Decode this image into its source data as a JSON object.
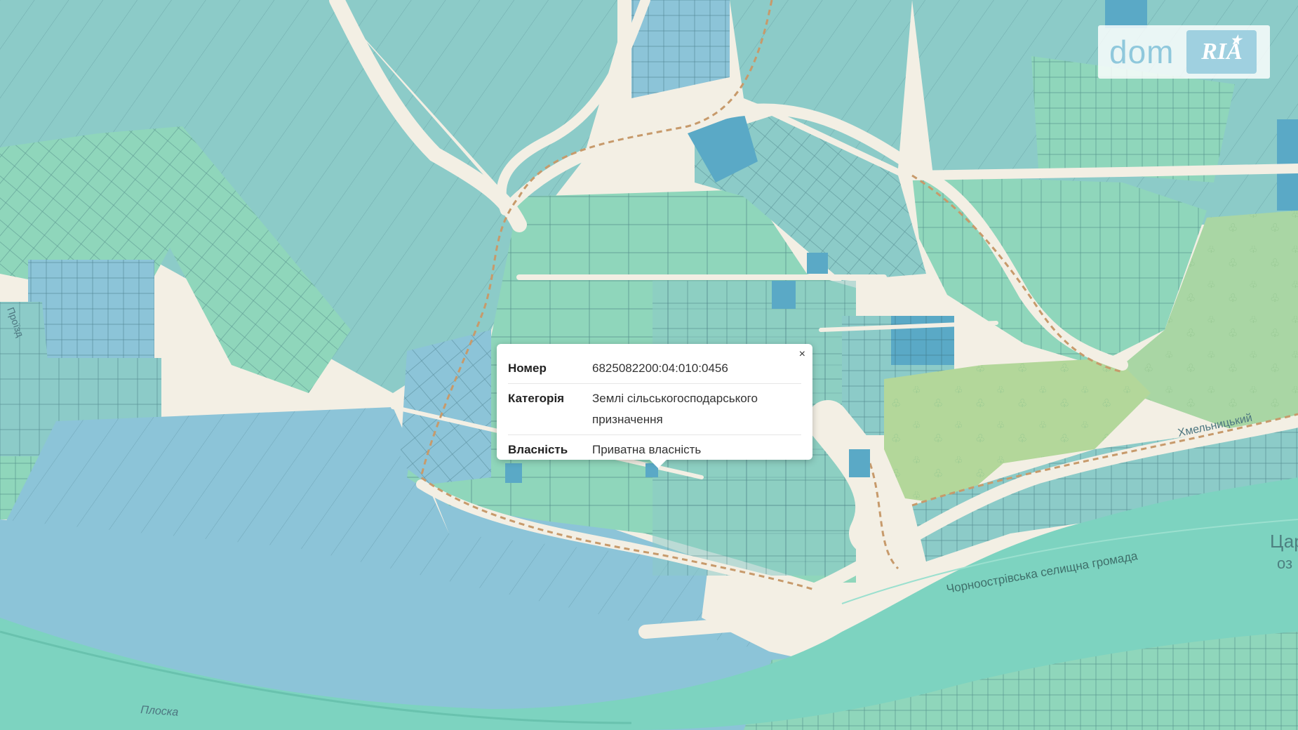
{
  "logo": {
    "text_dom": "dom",
    "text_ria": "RIA"
  },
  "popup": {
    "close_label": "×",
    "rows": [
      {
        "label": "Номер",
        "value": "6825082200:04:010:0456"
      },
      {
        "label": "Категорія",
        "value": "Землі сільськогосподарського призначення"
      },
      {
        "label": "Власність",
        "value": "Приватна власність"
      }
    ]
  },
  "map_labels": {
    "river_plosca": "Плоска",
    "community": "Чорноострівська селищна громада",
    "road_khmelnytskyi": "Хмельницький",
    "edge_tsar": "Цар",
    "edge_oz": "оз",
    "left_road": "Проїзд"
  },
  "colors": {
    "parcel_green": "#8fd6bb",
    "parcel_teal": "#8ccbc8",
    "parcel_blue": "#8cc4d8",
    "parcel_dark": "#5aa9c6",
    "water": "#7dd3c0",
    "forest": "#a9d6a4",
    "road": "#f3efe4",
    "parcel_line": "#2e5e6a"
  }
}
